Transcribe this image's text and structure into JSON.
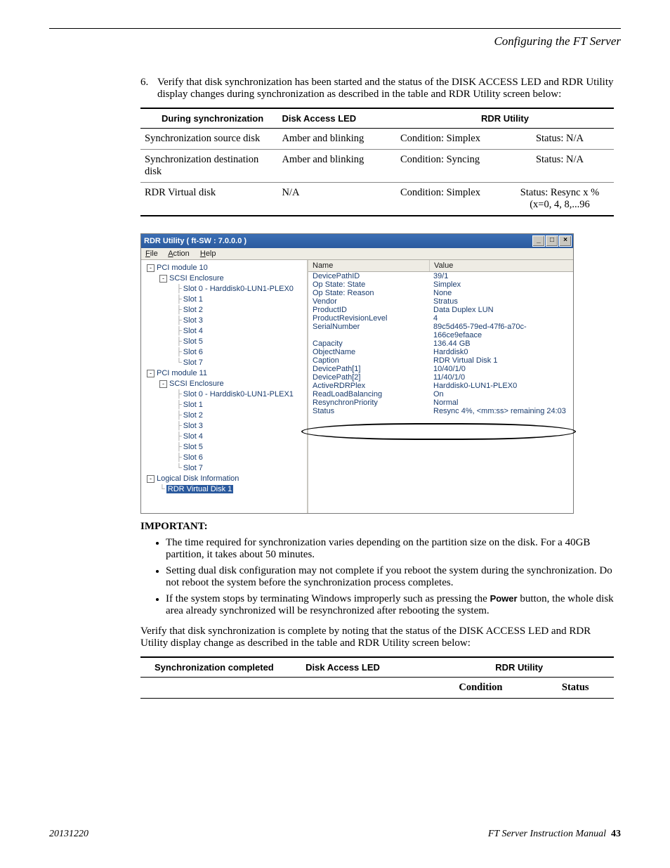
{
  "header": {
    "section_title": "Configuring the FT Server"
  },
  "step": {
    "num": "6.",
    "text": "Verify that disk synchronization has been started and the status of the DISK ACCESS LED and RDR Utility display changes during synchronization as described in the table and RDR Utility screen below:"
  },
  "table1": {
    "headers": {
      "h1": "During synchronization",
      "h2": "Disk Access LED",
      "h3": "RDR Utility"
    },
    "rows": [
      {
        "c1": "Synchronization source disk",
        "c2": "Amber and blinking",
        "c3": "Condition: Simplex",
        "c4": "Status: N/A"
      },
      {
        "c1": "Synchronization destination disk",
        "c2": "Amber and blinking",
        "c3": "Condition: Syncing",
        "c4": "Status: N/A"
      },
      {
        "c1": "RDR Virtual disk",
        "c2": "N/A",
        "c3": "Condition: Simplex",
        "c4a": "Status: Resync x %",
        "c4b": "(x=0, 4, 8,...96"
      }
    ]
  },
  "win": {
    "title": "RDR Utility  ( ft-SW : 7.0.0.0 )",
    "menu": {
      "file": "File",
      "action": "Action",
      "help": "Help"
    },
    "rhead": {
      "name": "Name",
      "value": "Value"
    },
    "tree": {
      "pci10": "PCI module  10",
      "scsi": "SCSI Enclosure",
      "slot0a": "Slot 0  -  Harddisk0-LUN1-PLEX0",
      "s1": "Slot 1",
      "s2": "Slot 2",
      "s3": "Slot 3",
      "s4": "Slot 4",
      "s5": "Slot 5",
      "s6": "Slot 6",
      "s7": "Slot 7",
      "pci11": "PCI module  11",
      "slot0b": "Slot 0  -  Harddisk0-LUN1-PLEX1",
      "logd": "Logical Disk Information",
      "rdr1": "RDR Virtual Disk 1"
    },
    "props": [
      {
        "n": "DevicePathID",
        "v": "39/1"
      },
      {
        "n": "Op State: State",
        "v": "Simplex"
      },
      {
        "n": "Op State: Reason",
        "v": "None"
      },
      {
        "n": "Vendor",
        "v": "Stratus"
      },
      {
        "n": "ProductID",
        "v": "Data Duplex LUN"
      },
      {
        "n": "ProductRevisionLevel",
        "v": "4"
      },
      {
        "n": "SerialNumber",
        "v": "89c5d465-79ed-47f6-a70c-166ce9efaace"
      },
      {
        "n": "Capacity",
        "v": "136.44 GB"
      },
      {
        "n": "ObjectName",
        "v": "Harddisk0"
      },
      {
        "n": "Caption",
        "v": "RDR Virtual Disk 1"
      },
      {
        "n": "DevicePath[1]",
        "v": "10/40/1/0"
      },
      {
        "n": "DevicePath[2]",
        "v": "11/40/1/0"
      },
      {
        "n": "ActiveRDRPlex",
        "v": "Harddisk0-LUN1-PLEX0"
      },
      {
        "n": "ReadLoadBalancing",
        "v": "On"
      },
      {
        "n": "ResynchronPriority",
        "v": "Normal"
      },
      {
        "n": "Status",
        "v": "Resync 4%, <mm:ss> remaining 24:03"
      }
    ]
  },
  "important": {
    "heading": "IMPORTANT:",
    "b1": "The time required for synchronization varies depending on the partition size on the disk. For a 40GB partition, it takes about 50 minutes.",
    "b2": "Setting dual disk configuration may not complete if you reboot the system during the synchronization. Do not reboot the system before the synchronization process completes.",
    "b3a": "If the system stops by terminating Windows improperly such as pressing the ",
    "b3b": "Power",
    "b3c": " button, the whole disk area already synchronized will be resynchronized after rebooting the system."
  },
  "para2": "Verify that disk synchronization is complete by noting that the status of the DISK ACCESS LED and RDR Utility display change as described in the table and RDR Utility screen below:",
  "table2": {
    "headers": {
      "h1": "Synchronization completed",
      "h2": "Disk Access LED",
      "h3": "RDR Utility"
    },
    "sub": {
      "cond": "Condition",
      "stat": "Status"
    }
  },
  "footer": {
    "date": "20131220",
    "manual": "FT Server Instruction Manual",
    "page": "43"
  }
}
